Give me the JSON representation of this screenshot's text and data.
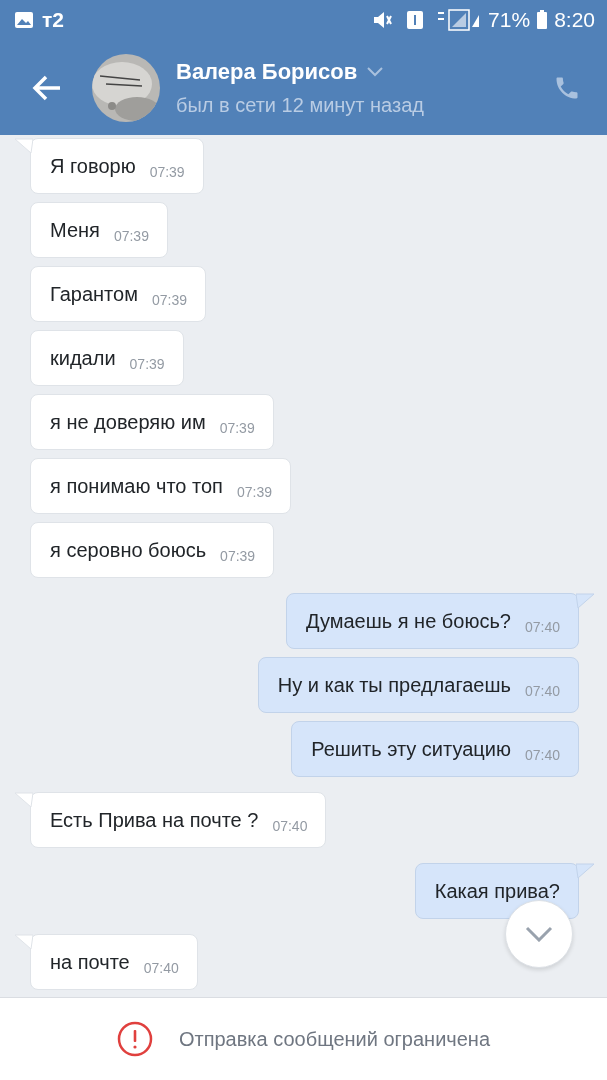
{
  "status_bar": {
    "carrier": "т2",
    "battery": "71%",
    "time": "8:20"
  },
  "header": {
    "name": "Валера Борисов",
    "last_seen": "был в сети 12 минут назад"
  },
  "messages": [
    {
      "text": "Я говорю",
      "time": "07:39",
      "outgoing": false,
      "tail": true
    },
    {
      "text": "Меня",
      "time": "07:39",
      "outgoing": false,
      "tail": false
    },
    {
      "text": "Гарантом",
      "time": "07:39",
      "outgoing": false,
      "tail": false
    },
    {
      "text": "кидали",
      "time": "07:39",
      "outgoing": false,
      "tail": false
    },
    {
      "text": "я не доверяю им",
      "time": "07:39",
      "outgoing": false,
      "tail": false
    },
    {
      "text": "я понимаю что топ",
      "time": "07:39",
      "outgoing": false,
      "tail": false
    },
    {
      "text": "я серовно боюсь",
      "time": "07:39",
      "outgoing": false,
      "tail": false
    },
    {
      "text": "Думаешь я не боюсь?",
      "time": "07:40",
      "outgoing": true,
      "tail": true
    },
    {
      "text": "Ну и как ты предлагаешь",
      "time": "07:40",
      "outgoing": true,
      "tail": false
    },
    {
      "text": "Решить эту ситуацию",
      "time": "07:40",
      "outgoing": true,
      "tail": false
    },
    {
      "text": "Есть Прива на почте ?",
      "time": "07:40",
      "outgoing": false,
      "tail": true
    },
    {
      "text": "Какая прива?",
      "outgoing": true,
      "tail": true
    },
    {
      "text": "на почте",
      "time": "07:40",
      "outgoing": false,
      "tail": true
    }
  ],
  "footer": {
    "notice": "Отправка сообщений ограничена"
  }
}
